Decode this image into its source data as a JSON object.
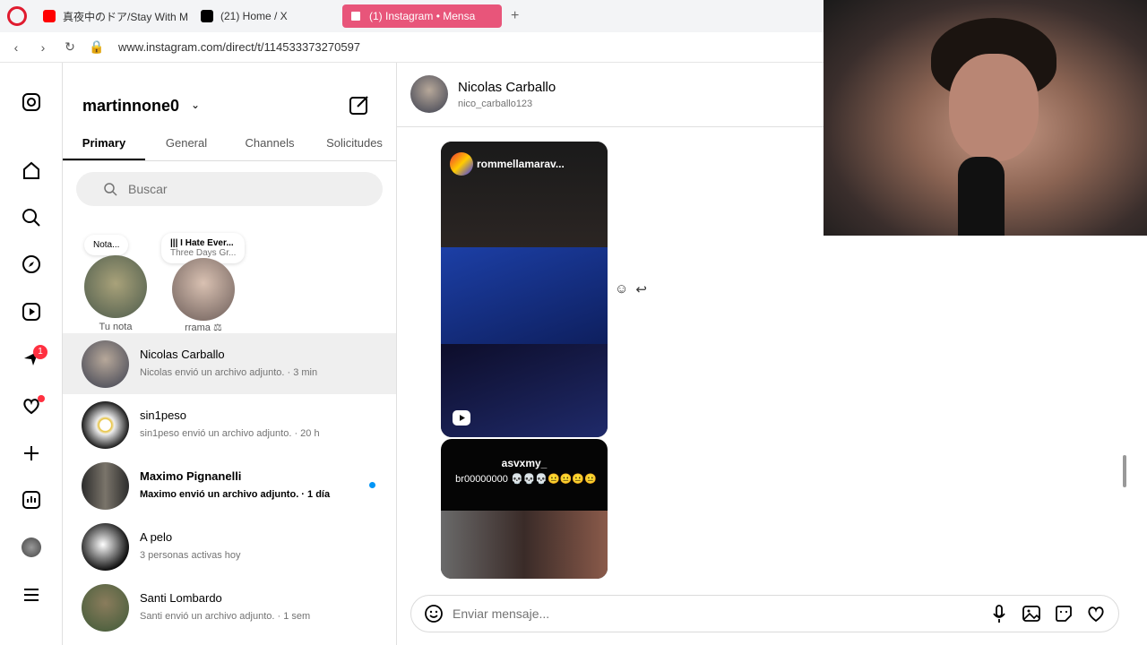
{
  "browser": {
    "tabs": [
      {
        "label": "真夜中のドア/Stay With Me",
        "color": "#ff0000"
      },
      {
        "label": "(21) Home / X",
        "color": "#000000"
      },
      {
        "label": "(1) Instagram • Mensa",
        "color": "#e8557a"
      }
    ],
    "url": "www.instagram.com/direct/t/114533373270597"
  },
  "leftnav": {
    "messages_badge": "1"
  },
  "sidebar": {
    "username": "martinnone0",
    "tabs": [
      "Primary",
      "General",
      "Channels",
      "Solicitudes"
    ],
    "search_placeholder": "Buscar",
    "notes": [
      {
        "note": "Nota...",
        "label": "Tu nota"
      },
      {
        "note_title": "||| I Hate Ever...",
        "note_sub": "Three Days Gr...",
        "label": "rrama ⚖"
      }
    ],
    "threads": [
      {
        "name": "Nicolas Carballo",
        "sub": "Nicolas envió un archivo adjunto. · 3 min"
      },
      {
        "name": "sin1peso",
        "sub": "sin1peso envió un archivo adjunto. · 20 h"
      },
      {
        "name": "Maximo Pignanelli",
        "sub": "Maximo envió un archivo adjunto. · 1 día"
      },
      {
        "name": "A pelo",
        "sub": "3 personas activas hoy"
      },
      {
        "name": "Santi Lombardo",
        "sub": "Santi envió un archivo adjunto. · 1 sem"
      }
    ]
  },
  "chat": {
    "name": "Nicolas Carballo",
    "handle": "nico_carballo123",
    "reel1_user": "rommellamarav...",
    "reel2_user": "asvxmy_",
    "reel2_caption": "br00000000 💀💀💀😐😐😐😐",
    "composer_placeholder": "Enviar mensaje..."
  }
}
